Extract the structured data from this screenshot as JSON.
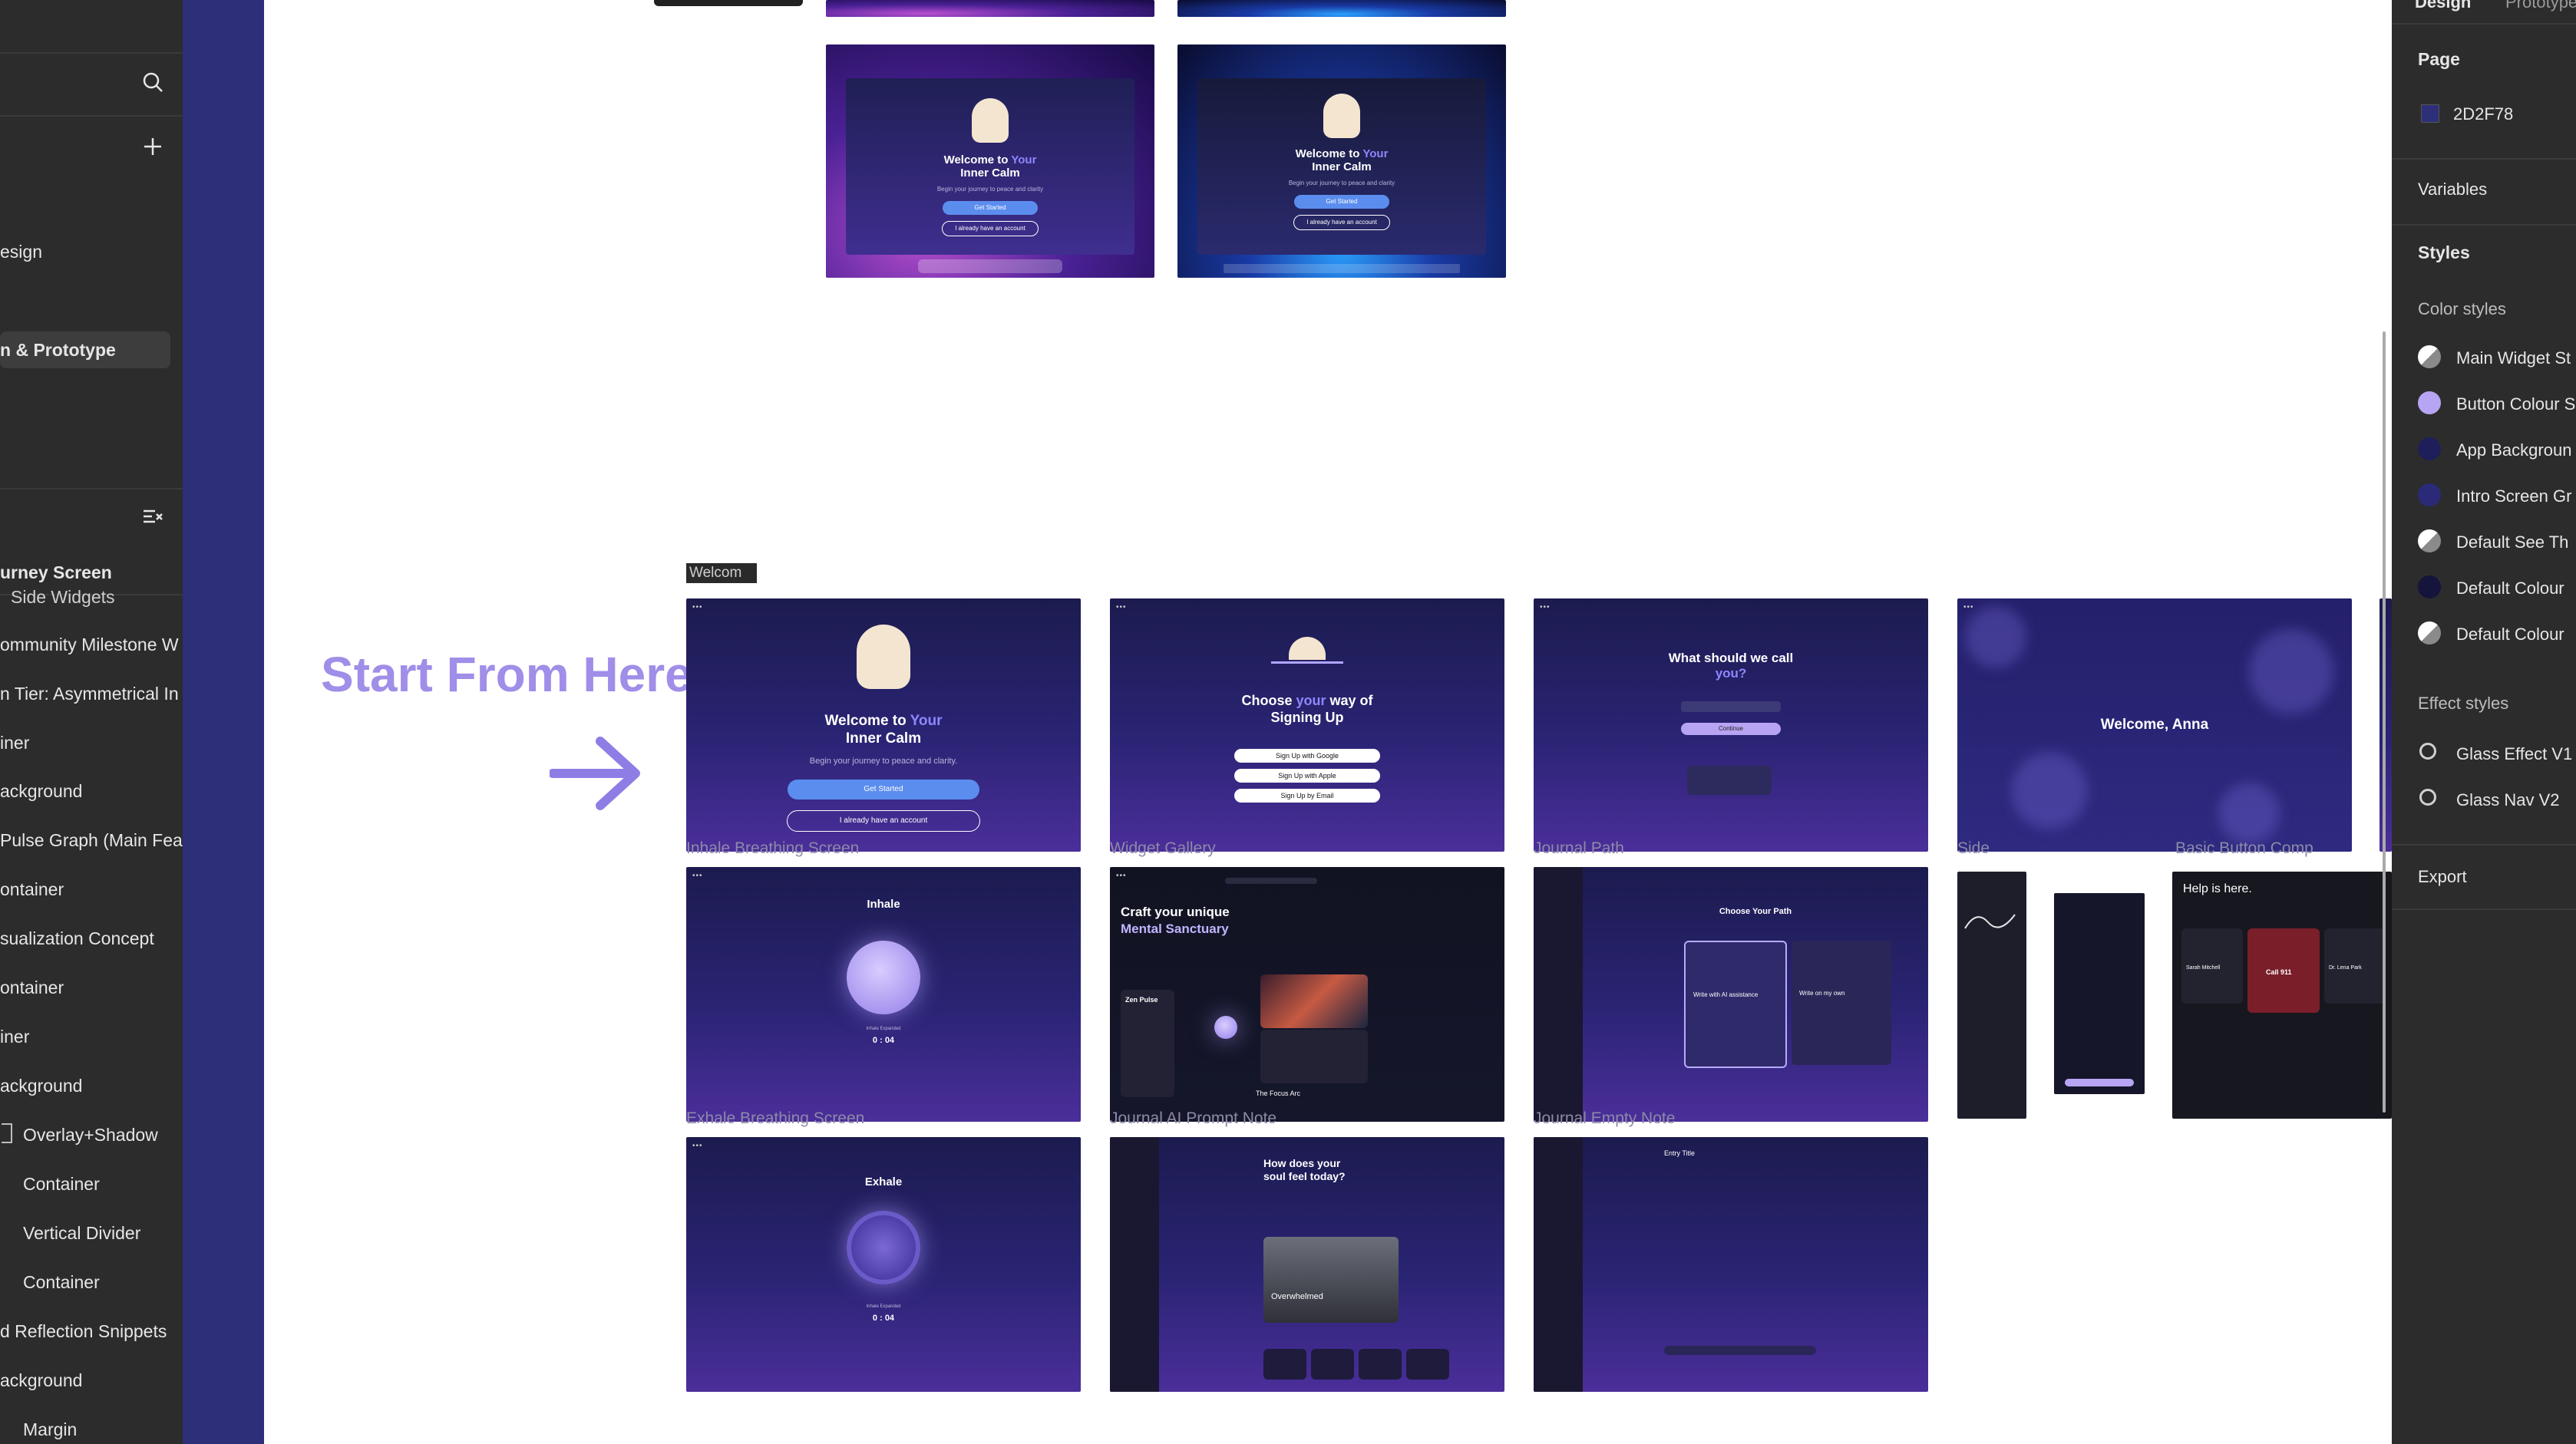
{
  "left_panel": {
    "pages": [
      "esign",
      "n & Prototype"
    ],
    "layers_title": "urney Screen",
    "layers": [
      "Side Widgets",
      "ommunity Milestone W",
      "n Tier: Asymmetrical In",
      "iner",
      "ackground",
      "Pulse Graph (Main Fea",
      "ontainer",
      "sualization Concept",
      "ontainer",
      "iner",
      "ackground",
      "Overlay+Shadow",
      "Container",
      "Vertical Divider",
      "Container",
      "d Reflection Snippets",
      "ackground",
      "Margin"
    ]
  },
  "right_panel": {
    "tabs": [
      "Design",
      "Prototype"
    ],
    "page_label": "Page",
    "page_color": "2D2F78",
    "variables_label": "Variables",
    "styles_label": "Styles",
    "color_styles_label": "Color styles",
    "color_styles": [
      {
        "name": "Main Widget St",
        "color": "#d9d9d9",
        "kind": "split"
      },
      {
        "name": "Button Colour S",
        "color": "#b7a4f2",
        "kind": "solid"
      },
      {
        "name": "App Backgroun",
        "color": "#1e1e5a",
        "kind": "solid"
      },
      {
        "name": "Intro Screen Gr",
        "color": "#2a2a78",
        "kind": "solid"
      },
      {
        "name": "Default See Th",
        "color": "#d9d9d9",
        "kind": "split"
      },
      {
        "name": "Default Colour",
        "color": "#14143c",
        "kind": "solid"
      },
      {
        "name": "Default Colour",
        "color": "#d9d9d9",
        "kind": "split"
      }
    ],
    "effect_styles_label": "Effect styles",
    "effect_styles": [
      "Glass Effect V1",
      "Glass Nav V2"
    ],
    "export_label": "Export"
  },
  "canvas": {
    "start_label": "Start From Here",
    "frame_tag": "Welcom",
    "frame_labels": [
      "Inhale Breathing Screen",
      "Widget Gallery",
      "Journal Path",
      "Side",
      "Basic Button Comp",
      "Exhale Breathing Screen",
      "Journal AI Prompt Note",
      "Journal Empty Note"
    ],
    "os_preview": {
      "title_a": "Welcome to ",
      "title_b": "Your",
      "title_c": "Inner Calm",
      "subtitle": "Begin your journey to peace and clarity",
      "primary": "Get Started",
      "secondary": "I already have an account"
    },
    "welcome": {
      "title_a": "Welcome to ",
      "title_b": "Your",
      "title_c": "Inner Calm",
      "subtitle": "Begin your journey to peace and clarity.",
      "primary": "Get Started",
      "secondary": "I already have an account"
    },
    "signup": {
      "title_a": "Choose ",
      "title_b": "your",
      "title_c": " way of",
      "title_d": "Signing Up",
      "google": "Sign Up with Google",
      "apple": "Sign Up with Apple",
      "email": "Sign Up by Email"
    },
    "name": {
      "title": "What should we call",
      "title2": "you?",
      "button": "Continue"
    },
    "welcome_anna": "Welcome, Anna",
    "inhale": {
      "title": "Inhale",
      "timer": "0 : 04",
      "caption": "Inhale Expanded"
    },
    "exhale": {
      "title": "Exhale",
      "timer": "0 : 04",
      "caption": "Inhale Expanded"
    },
    "gallery": {
      "title1": "Craft your unique",
      "title2": "Mental Sanctuary",
      "card": "Zen Pulse",
      "card2": "The Focus Arc"
    },
    "path": {
      "title": "Choose Your Path",
      "opt1": "Write with AI assistance",
      "opt2": "Write on my own"
    },
    "feeling": {
      "title1": "How does your",
      "title2": "soul feel today?",
      "mood": "Overwhelmed"
    },
    "entry_title": "Entry Title",
    "help": {
      "title": "Help is here.",
      "call": "Call 911",
      "p1": "Sarah Mitchell",
      "p2": "Dr. Lena Park"
    }
  }
}
